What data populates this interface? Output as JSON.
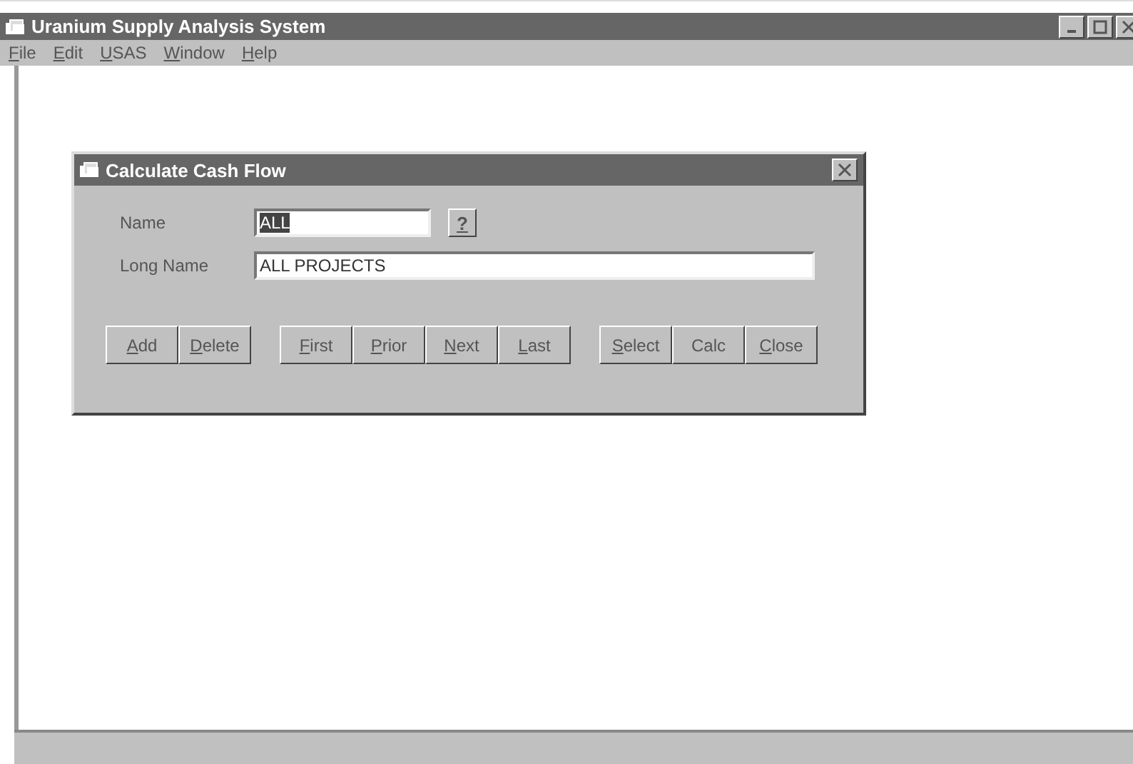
{
  "window": {
    "title": "Uranium Supply Analysis System"
  },
  "menu": [
    {
      "label": "File",
      "mnemonic": true
    },
    {
      "label": "Edit",
      "mnemonic": true
    },
    {
      "label": "USAS",
      "mnemonic": true
    },
    {
      "label": "Window",
      "mnemonic": true
    },
    {
      "label": "Help",
      "mnemonic": true
    }
  ],
  "dialog": {
    "title": "Calculate Cash Flow",
    "fields": [
      {
        "label": "Name",
        "value": "ALL",
        "selected": true,
        "lookup": "?"
      },
      {
        "label": "Long Name",
        "value": "ALL PROJECTS",
        "selected": false
      }
    ],
    "button_groups": [
      [
        {
          "label": "Add",
          "mnemonic": true
        },
        {
          "label": "Delete",
          "mnemonic": true
        }
      ],
      [
        {
          "label": "First",
          "mnemonic": true
        },
        {
          "label": "Prior",
          "mnemonic": true
        },
        {
          "label": "Next",
          "mnemonic": true
        },
        {
          "label": "Last",
          "mnemonic": true
        }
      ],
      [
        {
          "label": "Select",
          "mnemonic": true
        },
        {
          "label": "Calc",
          "mnemonic": false
        },
        {
          "label": "Close",
          "mnemonic": true
        }
      ]
    ]
  }
}
